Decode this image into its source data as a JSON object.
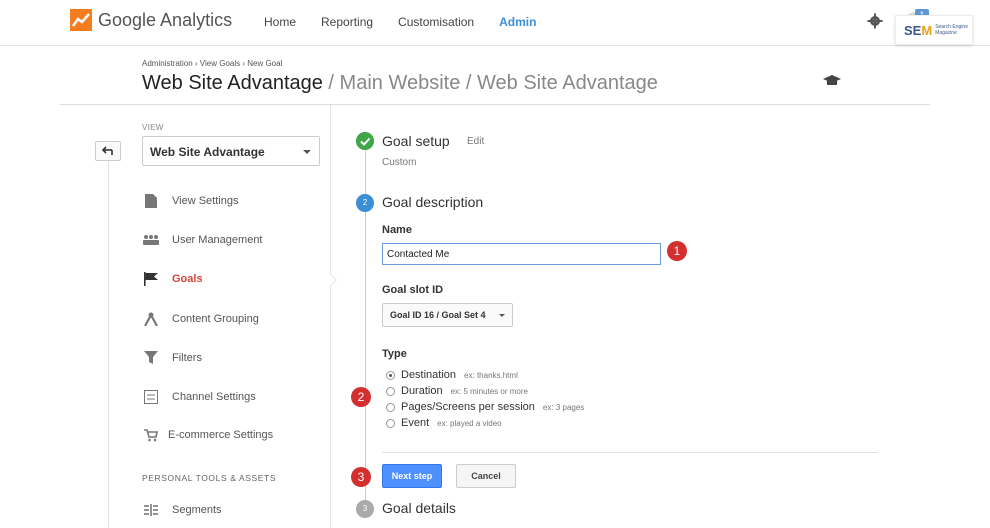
{
  "header": {
    "logo_text": "Google Analytics",
    "nav": [
      "Home",
      "Reporting",
      "Customisation",
      "Admin"
    ],
    "active_nav": "Admin",
    "account_badge": "1",
    "watermark_s": "SE",
    "watermark_m": "M",
    "watermark_sub": "Search Engine Magazine"
  },
  "breadcrumb": "Administration › View Goals › New Goal",
  "title": {
    "main": "Web Site Advantage",
    "sub": " / Main Website / Web Site Advantage"
  },
  "sidebar": {
    "view_label": "VIEW",
    "view_select": "Web Site Advantage",
    "items": [
      {
        "label": "View Settings",
        "icon": "document-icon"
      },
      {
        "label": "User Management",
        "icon": "users-icon"
      },
      {
        "label": "Goals",
        "icon": "flag-icon"
      },
      {
        "label": "Content Grouping",
        "icon": "grouping-icon"
      },
      {
        "label": "Filters",
        "icon": "filter-icon"
      },
      {
        "label": "Channel Settings",
        "icon": "channel-icon"
      },
      {
        "label": "E-commerce Settings",
        "icon": "cart-icon"
      }
    ],
    "section_label": "PERSONAL TOOLS & ASSETS",
    "segments_label": "Segments"
  },
  "goal": {
    "setup_title": "Goal setup",
    "edit_label": "Edit",
    "setup_value": "Custom",
    "description_step": "2",
    "description_title": "Goal description",
    "name_label": "Name",
    "name_value": "Contacted Me",
    "slot_label": "Goal slot ID",
    "slot_value": "Goal ID 16 / Goal Set 4",
    "type_label": "Type",
    "types": [
      {
        "label": "Destination",
        "example": "ex: thanks.html",
        "checked": true
      },
      {
        "label": "Duration",
        "example": "ex: 5 minutes or more",
        "checked": false
      },
      {
        "label": "Pages/Screens per session",
        "example": "ex: 3 pages",
        "checked": false
      },
      {
        "label": "Event",
        "example": "ex: played a video",
        "checked": false
      }
    ],
    "next_label": "Next step",
    "cancel_label": "Cancel",
    "details_step": "3",
    "details_title": "Goal details"
  },
  "callouts": [
    "1",
    "2",
    "3"
  ],
  "colors": {
    "accent": "#4d90fe",
    "active_menu": "#d0463a",
    "callout": "#d32f2f",
    "check_green": "#3fa64a",
    "step_blue": "#3b8fd4"
  }
}
